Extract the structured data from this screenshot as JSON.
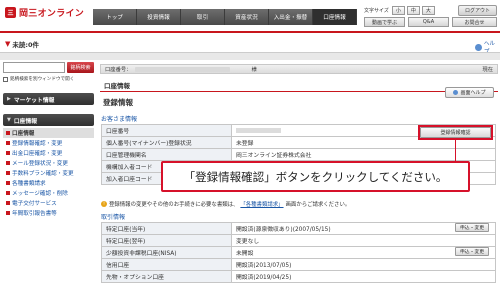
{
  "header": {
    "logo_text": "岡三オンライン",
    "nav": [
      "トップ",
      "投資情報",
      "取引",
      "資産状況",
      "入出金・振替",
      "口座情報"
    ],
    "font_size_label": "文字サイズ",
    "font_sizes": [
      "小",
      "中",
      "大"
    ],
    "logout_label": "ログアウト",
    "util_links": [
      "動画で学ぶ",
      "Q&A",
      "お問合せ"
    ]
  },
  "notice": {
    "label": "未読:0件"
  },
  "help_link": "ヘルプ",
  "sidebar": {
    "search_button": "銘柄検索",
    "search_hint": "銘柄検索を別ウィンドウで開く",
    "market_head": "マーケット情報",
    "account_head": "口座情報",
    "items": [
      "口座情報",
      "登録情報確認・変更",
      "出金口座確認・変更",
      "メール登録状況・変更",
      "手数料プラン確認・変更",
      "各種書類請求",
      "メッセージ確認・削除",
      "電子交付サービス",
      "年間取引報告書等"
    ]
  },
  "account_bar": {
    "label": "口座番号：",
    "suffix": "様",
    "current": "現在"
  },
  "page": {
    "section": "口座情報",
    "title": "登録情報",
    "help_button": "画面ヘルプ",
    "customer_section": "お客さま情報",
    "register_button": "登録情報確認",
    "callout": "「登録情報確認」ボタンをクリックしてください。",
    "info_text_1": "登録情報の変更やその他のお手続きに必要な書類は、",
    "info_link": "「各種書類請求」",
    "info_text_2": "画面からご請求ください。",
    "trade_section": "取引情報"
  },
  "customer_table": [
    {
      "key": "口座番号",
      "value": ""
    },
    {
      "key": "個人番号(マイナンバー)登録状況",
      "value": "未登録"
    },
    {
      "key": "口座管理機関名",
      "value": "岡三オンライン証券株式会社"
    },
    {
      "key": "機構加入者コード",
      "value": ""
    },
    {
      "key": "加入者口座コード",
      "value": ""
    }
  ],
  "trade_table": [
    {
      "key": "特定口座(当年)",
      "value": "開設済(源泉徴収あり)(2007/05/15)",
      "button": "申込・変更"
    },
    {
      "key": "特定口座(翌年)",
      "value": "変更なし",
      "button": ""
    },
    {
      "key": "少額投資非課税口座(NISA)",
      "value": "未開設",
      "button": "申込・変更"
    },
    {
      "key": "信用口座",
      "value": "開設済(2013/07/05)",
      "button": ""
    },
    {
      "key": "先物・オプション口座",
      "value": "開設済(2019/04/25)",
      "button": ""
    }
  ]
}
